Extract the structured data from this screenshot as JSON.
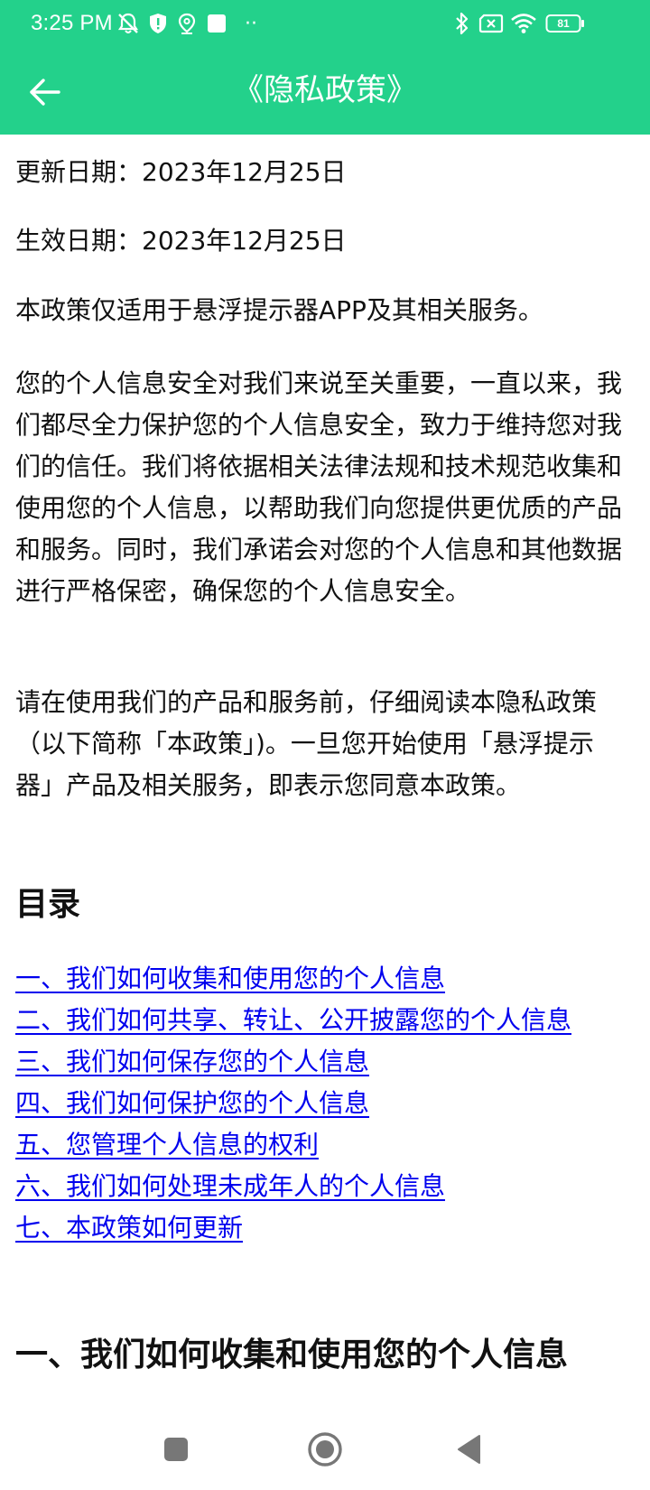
{
  "status_bar": {
    "time": "3:25 PM",
    "battery": "81",
    "dots": "··",
    "colors": {
      "background": "#23D18B",
      "foreground": "#FFFFFF"
    },
    "icons": [
      "notifications-off-icon",
      "shield-alert-icon",
      "location-icon",
      "app-square-icon",
      "bluetooth-icon",
      "sim-off-icon",
      "wifi-icon",
      "battery-icon"
    ]
  },
  "app_bar": {
    "title": "《隐私政策》",
    "back_icon": "arrow-left-icon"
  },
  "content": {
    "update_date": "更新日期：2023年12月25日",
    "effective_date": "生效日期：2023年12月25日",
    "scope": "本政策仅适用于悬浮提示器APP及其相关服务。",
    "intro": "您的个人信息安全对我们来说至关重要，一直以来，我们都尽全力保护您的个人信息安全，致力于维持您对我们的信任。我们将依据相关法律法规和技术规范收集和使用您的个人信息，以帮助我们向您提供更优质的产品和服务。同时，我们承诺会对您的个人信息和其他数据进行严格保密，确保您的个人信息安全。",
    "reading_notice": "请在使用我们的产品和服务前，仔细阅读本隐私政策（以下简称「本政策」)。一旦您开始使用「悬浮提示器」产品及相关服务，即表示您同意本政策。",
    "toc_heading": "目录",
    "toc": [
      "一、我们如何收集和使用您的个人信息",
      "二、我们如何共享、转让、公开披露您的个人信息",
      "三、我们如何保存您的个人信息",
      "四、我们如何保护您的个人信息",
      "五、您管理个人信息的权利",
      "六、我们如何处理未成年人的个人信息",
      "七、本政策如何更新"
    ],
    "section1_heading": "一、我们如何收集和使用您的个人信息",
    "link_color": "#0000EE"
  },
  "nav_bar": {
    "buttons": [
      "recent-apps-icon",
      "home-icon",
      "back-icon"
    ]
  }
}
